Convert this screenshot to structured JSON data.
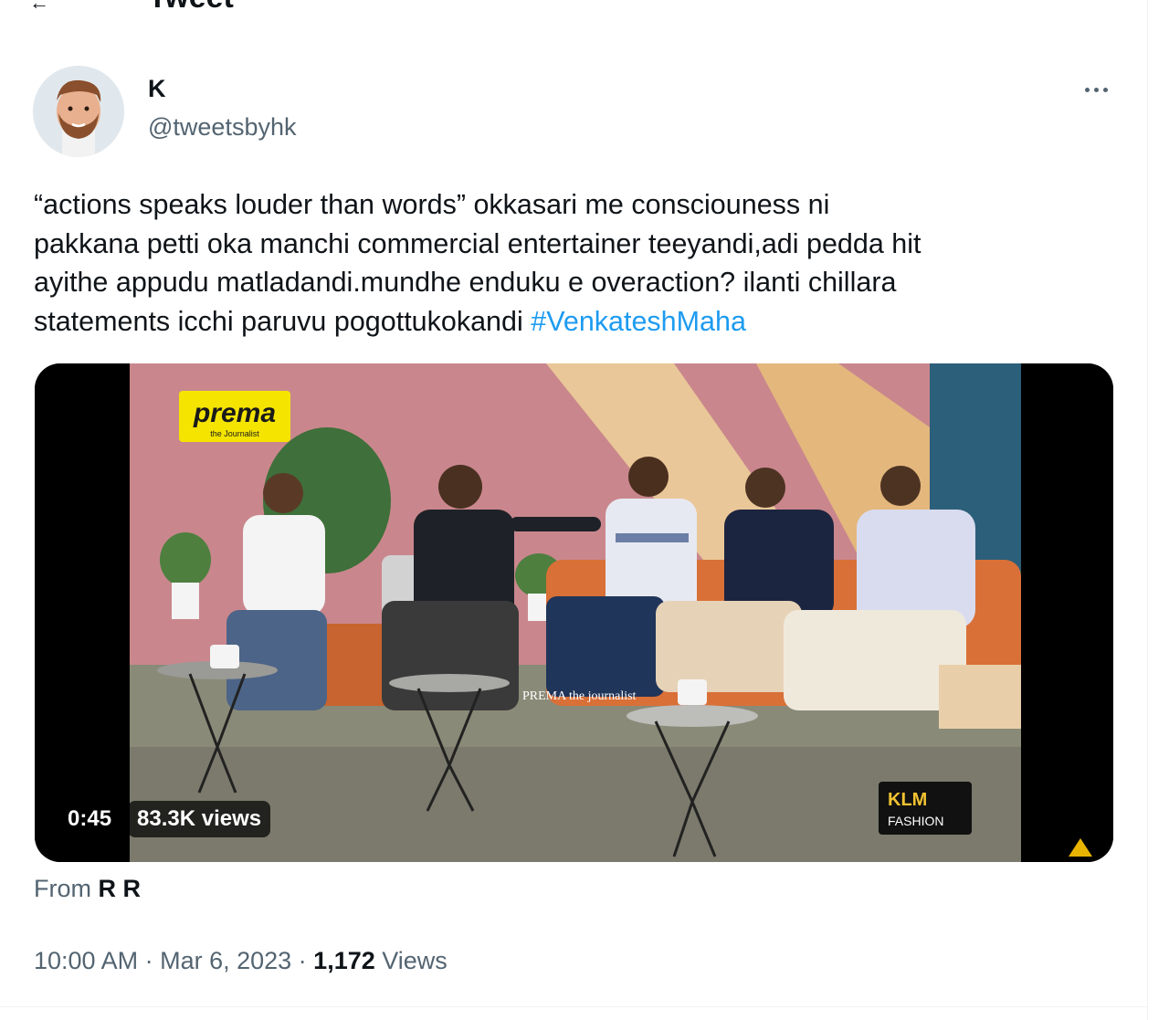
{
  "header": {
    "title": "Tweet"
  },
  "author": {
    "display_name": "K",
    "handle": "@tweetsbyhk"
  },
  "tweet": {
    "text": "“actions speaks louder than words” okkasari me consciouness ni\npakkana petti oka manchi commercial entertainer teeyandi,adi pedda hit\nayithe appudu matladandi.mundhe enduku e overaction? ilanti chillara\nstatements icchi paruvu pogottukokandi ",
    "hashtag": "#VenkateshMaha"
  },
  "video": {
    "duration": "0:45",
    "views": "83.3K views",
    "logo_main": "prema",
    "logo_sub": "the Journalist",
    "caption": "PREMA the journalist",
    "sponsor_line1": "KLM",
    "sponsor_line2": "FASHION"
  },
  "source": {
    "label": "From",
    "name": "R R"
  },
  "meta": {
    "time": "10:00 AM",
    "sep1": " · ",
    "date": "Mar 6, 2023",
    "sep2": " · ",
    "views_count": "1,172",
    "views_label": " Views"
  },
  "icons": {
    "more": "more-horizontal-icon",
    "back": "arrow-left-icon"
  }
}
